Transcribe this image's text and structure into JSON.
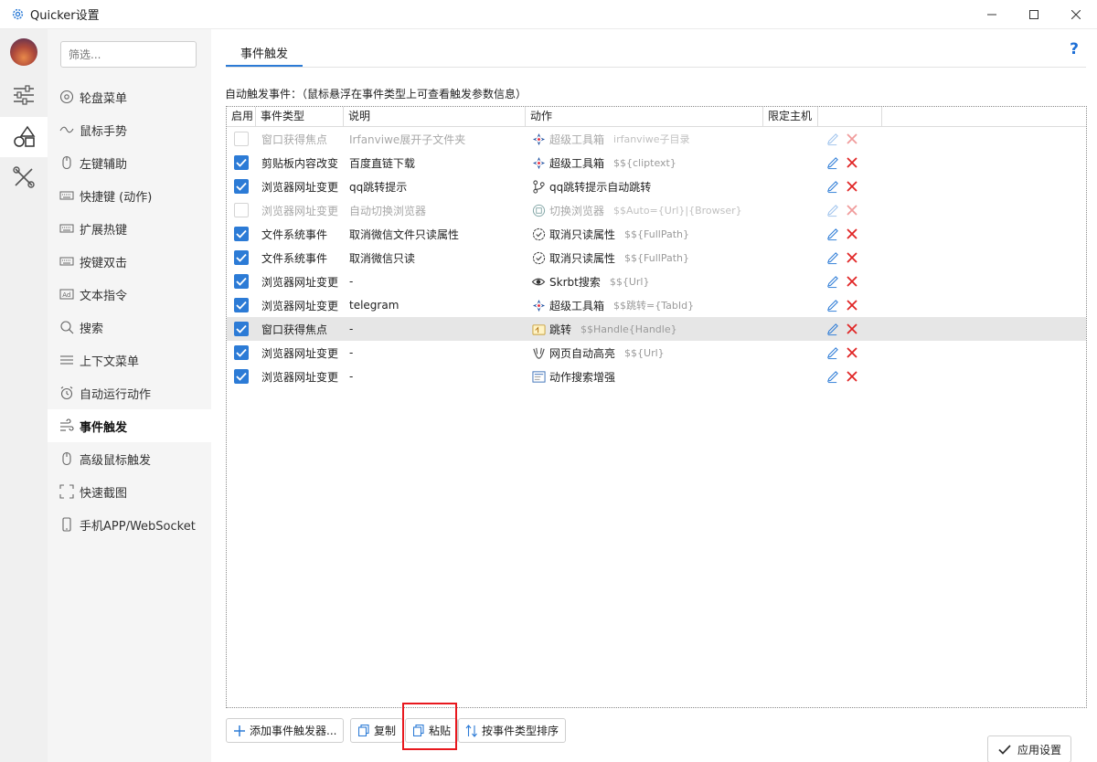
{
  "window": {
    "title": "Quicker设置",
    "minimize": "—",
    "maximize": "☐",
    "close": "✕"
  },
  "search": {
    "placeholder": "筛选..."
  },
  "nav": {
    "items": [
      {
        "label": "轮盘菜单",
        "icon": "wheel-icon"
      },
      {
        "label": "鼠标手势",
        "icon": "gesture-icon"
      },
      {
        "label": "左键辅助",
        "icon": "mouse-icon"
      },
      {
        "label": "快捷键 (动作)",
        "icon": "keyboard-icon"
      },
      {
        "label": "扩展热键",
        "icon": "keyboard-icon"
      },
      {
        "label": "按键双击",
        "icon": "keyboard-icon"
      },
      {
        "label": "文本指令",
        "icon": "ad-icon"
      },
      {
        "label": "搜索",
        "icon": "search-icon"
      },
      {
        "label": "上下文菜单",
        "icon": "menu-icon"
      },
      {
        "label": "自动运行动作",
        "icon": "alarm-icon"
      },
      {
        "label": "事件触发",
        "icon": "event-icon"
      },
      {
        "label": "高级鼠标触发",
        "icon": "mouse-icon"
      },
      {
        "label": "快速截图",
        "icon": "screenshot-icon"
      },
      {
        "label": "手机APP/WebSocket",
        "icon": "phone-icon"
      }
    ],
    "active_index": 10
  },
  "main": {
    "tab_label": "事件触发",
    "help": "?",
    "section_label": "自动触发事件：（鼠标悬浮在事件类型上可查看触发参数信息）",
    "columns": [
      "启用",
      "事件类型",
      "说明",
      "动作",
      "限定主机",
      "",
      ""
    ],
    "rows": [
      {
        "enabled": false,
        "type": "窗口获得焦点",
        "desc": "Irfanviwe展开子文件夹",
        "action": "超级工具箱",
        "param": "irfanviwe子目录",
        "icon": "toolbox-icon"
      },
      {
        "enabled": true,
        "type": "剪贴板内容改变",
        "desc": "百度直链下载",
        "action": "超级工具箱",
        "param": "$${cliptext}",
        "icon": "toolbox-icon"
      },
      {
        "enabled": true,
        "type": "浏览器网址变更",
        "desc": "qq跳转提示",
        "action": "qq跳转提示自动跳转",
        "param": "",
        "icon": "branch-icon"
      },
      {
        "enabled": false,
        "type": "浏览器网址变更",
        "desc": "自动切换浏览器",
        "action": "切换浏览器",
        "param": "$$Auto={Url}|{Browser}",
        "icon": "browser-switch-icon"
      },
      {
        "enabled": true,
        "type": "文件系统事件",
        "desc": "取消微信文件只读属性",
        "action": "取消只读属性",
        "param": "$${FullPath}",
        "icon": "check-circle-icon"
      },
      {
        "enabled": true,
        "type": "文件系统事件",
        "desc": "取消微信只读",
        "action": "取消只读属性",
        "param": "$${FullPath}",
        "icon": "check-circle-icon"
      },
      {
        "enabled": true,
        "type": "浏览器网址变更",
        "desc": "-",
        "action": "Skrbt搜索",
        "param": "$${Url}",
        "icon": "eye-icon"
      },
      {
        "enabled": true,
        "type": "浏览器网址变更",
        "desc": "telegram",
        "action": "超级工具箱",
        "param": "$$跳转={TabId}",
        "icon": "toolbox-icon"
      },
      {
        "enabled": true,
        "type": "窗口获得焦点",
        "desc": "-",
        "action": "跳转",
        "param": "$$Handle{Handle}",
        "icon": "jump-icon",
        "selected": true
      },
      {
        "enabled": true,
        "type": "浏览器网址变更",
        "desc": "-",
        "action": "网页自动高亮",
        "param": "$${Url}",
        "icon": "highlight-icon"
      },
      {
        "enabled": true,
        "type": "浏览器网址变更",
        "desc": "-",
        "action": "动作搜索增强",
        "param": "",
        "icon": "search-enhance-icon"
      }
    ]
  },
  "buttons": {
    "add": "添加事件触发器...",
    "copy": "复制",
    "paste": "粘贴",
    "sort": "按事件类型排序",
    "apply": "应用设置"
  },
  "colors": {
    "accent": "#2c7bd6",
    "delete": "#e02424",
    "highlight_box": "#e8181e"
  }
}
